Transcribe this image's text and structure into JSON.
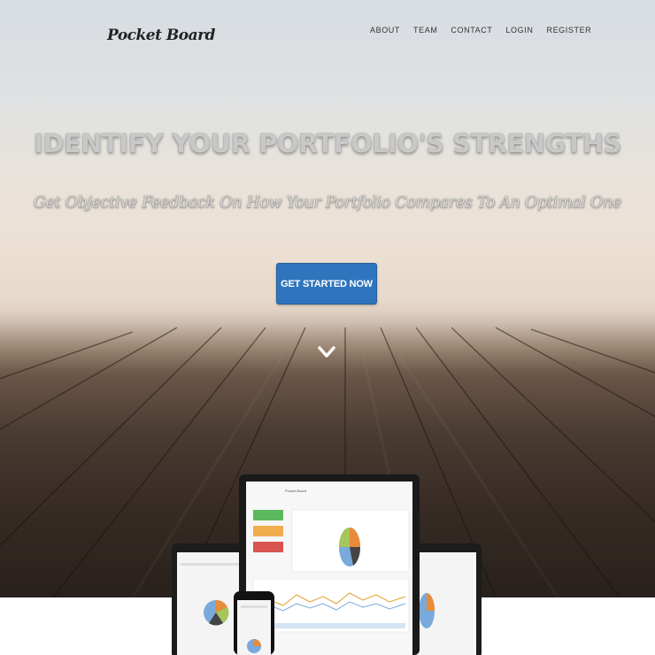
{
  "brand": {
    "logo_text": "Pocket Board"
  },
  "nav": {
    "items": [
      "ABOUT",
      "TEAM",
      "CONTACT",
      "LOGIN",
      "REGISTER"
    ]
  },
  "hero": {
    "headline": "IDENTIFY YOUR PORTFOLIO'S STRENGTHS",
    "subheadline": "Get Objective Feedback On How Your Portfolio Compares To An Optimal One",
    "cta_label": "GET STARTED NOW",
    "scroll_icon": "chevron-down-icon"
  },
  "device_mockup": {
    "laptop_title": "Pocket Board"
  },
  "colors": {
    "cta": "#2f75bd",
    "hero_text": "#c8c8c8",
    "nav_text": "#333333"
  }
}
